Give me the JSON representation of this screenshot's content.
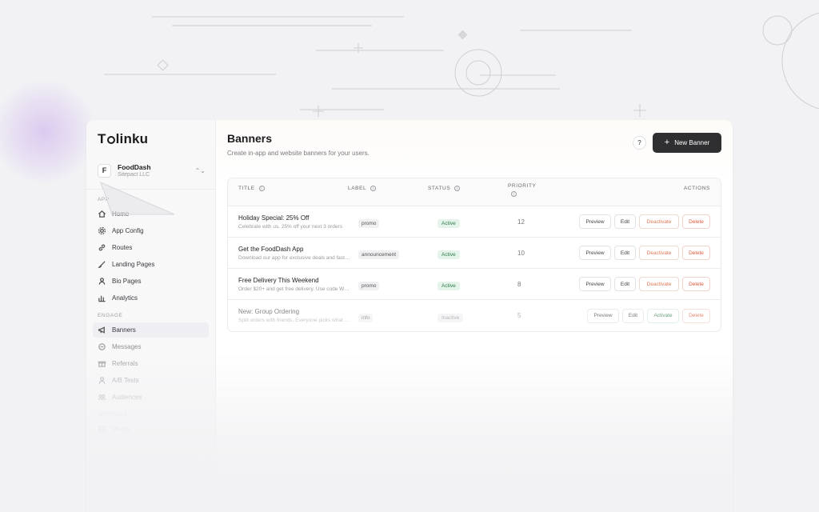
{
  "brand": {
    "logo_text": "Tolinku",
    "logo_prefix": "T",
    "logo_suffix": "linku"
  },
  "org": {
    "initial": "F",
    "name": "FoodDash",
    "subtitle": "Sitepact LLC"
  },
  "sidebar": {
    "sections": [
      {
        "label": "APP",
        "items": [
          {
            "label": "Home",
            "icon": "home-icon"
          },
          {
            "label": "App Config",
            "icon": "gear-icon"
          },
          {
            "label": "Routes",
            "icon": "link-icon"
          },
          {
            "label": "Landing Pages",
            "icon": "brush-icon"
          },
          {
            "label": "Bio Pages",
            "icon": "user-icon"
          },
          {
            "label": "Analytics",
            "icon": "bar-chart-icon"
          }
        ]
      },
      {
        "label": "ENGAGE",
        "items": [
          {
            "label": "Banners",
            "icon": "megaphone-icon",
            "active": true
          },
          {
            "label": "Messages",
            "icon": "chat-icon"
          },
          {
            "label": "Referrals",
            "icon": "gift-icon"
          },
          {
            "label": "A/B Tests",
            "icon": "users-icon"
          },
          {
            "label": "Audiences",
            "icon": "group-icon"
          }
        ]
      },
      {
        "label": "SETTINGS",
        "items": [
          {
            "label": "Media",
            "icon": "image-icon"
          }
        ]
      }
    ]
  },
  "header": {
    "title": "Banners",
    "subtitle": "Create in-app and website banners for your users.",
    "help_label": "?",
    "new_button_label": "New Banner"
  },
  "table": {
    "columns": {
      "title": "TITLE",
      "label": "LABEL",
      "status": "STATUS",
      "priority": "PRIORITY",
      "actions": "ACTIONS"
    },
    "rows": [
      {
        "title": "Holiday Special: 25% Off",
        "desc": "Celebrate with us. 25% off your next 3 orders",
        "label": "promo",
        "status": "Active",
        "priority": "12",
        "toggle": "Deactivate"
      },
      {
        "title": "Get the FoodDash App",
        "desc": "Download our app for exclusive deals and faster ordering",
        "label": "announcement",
        "status": "Active",
        "priority": "10",
        "toggle": "Deactivate"
      },
      {
        "title": "Free Delivery This Weekend",
        "desc": "Order $20+ and get free delivery. Use code WEEKEND",
        "label": "promo",
        "status": "Active",
        "priority": "8",
        "toggle": "Deactivate"
      },
      {
        "title": "New: Group Ordering",
        "desc": "Split orders with friends. Everyone picks what they want",
        "label": "info",
        "status": "Inactive",
        "priority": "5",
        "toggle": "Activate"
      }
    ],
    "actions": {
      "preview": "Preview",
      "edit": "Edit",
      "delete": "Delete"
    }
  },
  "colors": {
    "accent_dark": "#2f2f31",
    "active_green": "#2f7a4a",
    "deactivate_orange": "#e07a55",
    "delete_red": "#e0593a"
  }
}
